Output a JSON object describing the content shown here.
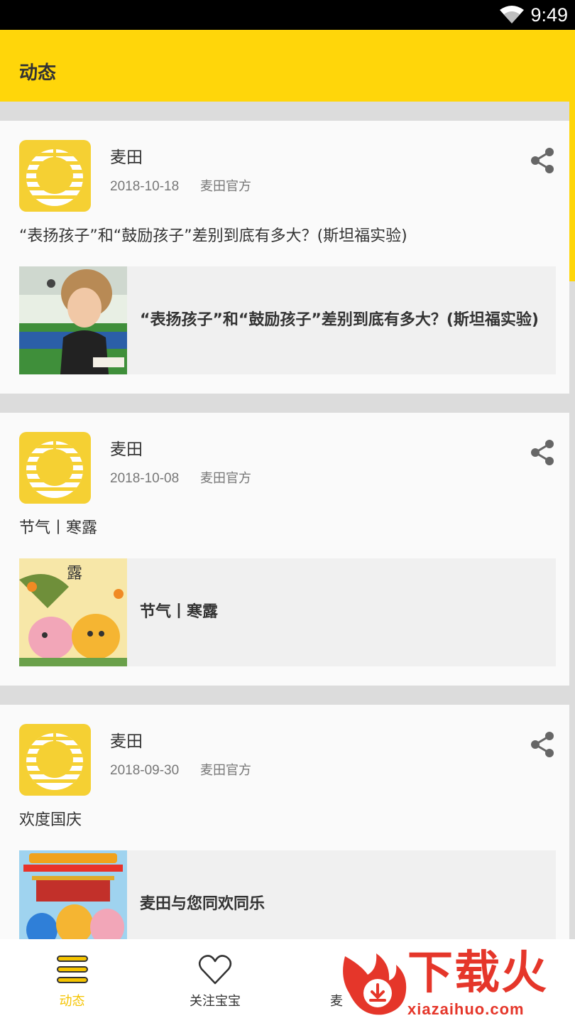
{
  "status_bar": {
    "time": "9:49"
  },
  "app_bar": {
    "title": "动态"
  },
  "posts": [
    {
      "author": "麦田",
      "date": "2018-10-18",
      "source": "麦田官方",
      "text": "“表扬孩子”和“鼓励孩子”差别到底有多大？(斯坦福实验)",
      "link_title": "“表扬孩子”和“鼓励孩子”差别到底有多大？(斯坦福实验)"
    },
    {
      "author": "麦田",
      "date": "2018-10-08",
      "source": "麦田官方",
      "text": "节气丨寒露",
      "link_title": "节气丨寒露",
      "thumb_text": "露"
    },
    {
      "author": "麦田",
      "date": "2018-09-30",
      "source": "麦田官方",
      "text": "欢度国庆",
      "link_title": "麦田与您同欢同乐"
    }
  ],
  "bottom_nav": {
    "items": [
      {
        "label": "动态",
        "icon": "menu-lines-icon",
        "active": true
      },
      {
        "label": "关注宝宝",
        "icon": "heart-icon",
        "active": false
      },
      {
        "label": "麦",
        "icon": "store-icon",
        "active": false
      }
    ]
  },
  "watermark": {
    "main": "下载火",
    "sub": "xiazaihuo.com"
  },
  "colors": {
    "accent": "#ffd60a",
    "active_label": "#f5c400",
    "divider": "#dcdcdc",
    "card": "#fafafa",
    "link_bg": "#f0f0f0",
    "watermark": "#e5362a"
  }
}
